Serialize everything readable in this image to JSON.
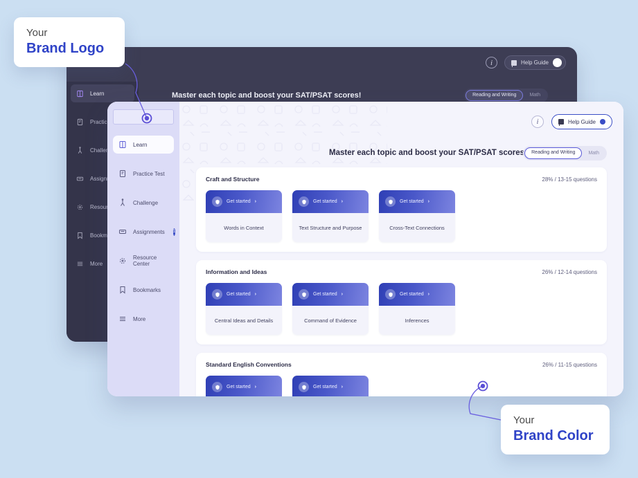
{
  "background_color": "#cbdff2",
  "brand_color": "#3b4ec6",
  "callouts": [
    {
      "id": "brand-logo",
      "small": "Your",
      "big": "Brand Logo"
    },
    {
      "id": "brand-color",
      "small": "Your",
      "big": "Brand Color"
    }
  ],
  "dark_window": {
    "topbar": {
      "info_icon": "info-icon",
      "help_guide_label": "Help Guide",
      "help_guide_toggle": "on"
    },
    "sidebar": {
      "items": [
        {
          "label": "Learn",
          "icon": "learn-icon",
          "active": true
        },
        {
          "label": "Practice Test",
          "icon": "practice-test-icon",
          "active": false
        },
        {
          "label": "Challenge",
          "icon": "challenge-icon",
          "active": false
        },
        {
          "label": "Assignments",
          "icon": "assignments-icon",
          "active": false
        },
        {
          "label": "Resource Center",
          "icon": "resource-center-icon",
          "active": false
        },
        {
          "label": "Bookmarks",
          "icon": "bookmarks-icon",
          "active": false
        },
        {
          "label": "More",
          "icon": "more-icon",
          "active": false
        }
      ]
    },
    "title": "Master each topic and boost your SAT/PSAT scores!",
    "tabs": [
      {
        "label": "Reading and Writing",
        "active": true
      },
      {
        "label": "Math",
        "active": false
      }
    ]
  },
  "light_window": {
    "topbar": {
      "info_icon": "info-icon",
      "help_guide_label": "Help Guide",
      "help_guide_toggle": "on"
    },
    "sidebar": {
      "logo_placeholder": "",
      "items": [
        {
          "label": "Learn",
          "icon": "learn-icon",
          "active": true,
          "badge": ""
        },
        {
          "label": "Practice Test",
          "icon": "practice-test-icon",
          "active": false,
          "badge": ""
        },
        {
          "label": "Challenge",
          "icon": "challenge-icon",
          "active": false,
          "badge": ""
        },
        {
          "label": "Assignments",
          "icon": "assignments-icon",
          "active": false,
          "badge": "1"
        },
        {
          "label": "Resource Center",
          "icon": "resource-center-icon",
          "active": false,
          "badge": ""
        },
        {
          "label": "Bookmarks",
          "icon": "bookmarks-icon",
          "active": false,
          "badge": ""
        },
        {
          "label": "More",
          "icon": "more-icon",
          "active": false,
          "badge": ""
        }
      ]
    },
    "title": "Master each topic and boost your SAT/PSAT scores!",
    "tabs": [
      {
        "label": "Reading and Writing",
        "active": true
      },
      {
        "label": "Math",
        "active": false
      }
    ],
    "sections": [
      {
        "title": "Craft and Structure",
        "meta": "28% / 13-15 questions",
        "cards": [
          {
            "cta": "Get started",
            "chevron": "›",
            "name": "Words in Context"
          },
          {
            "cta": "Get started",
            "chevron": "›",
            "name": "Text Structure and Purpose"
          },
          {
            "cta": "Get started",
            "chevron": "›",
            "name": "Cross-Text Connections"
          }
        ]
      },
      {
        "title": "Information and Ideas",
        "meta": "26% / 12-14 questions",
        "cards": [
          {
            "cta": "Get started",
            "chevron": "›",
            "name": "Central Ideas and Details"
          },
          {
            "cta": "Get started",
            "chevron": "›",
            "name": "Command of Evidence"
          },
          {
            "cta": "Get started",
            "chevron": "›",
            "name": "Inferences"
          }
        ]
      },
      {
        "title": "Standard English Conventions",
        "meta": "26% / 11-15 questions",
        "cards": [
          {
            "cta": "Get started",
            "chevron": "›",
            "name": ""
          },
          {
            "cta": "Get started",
            "chevron": "›",
            "name": ""
          }
        ]
      }
    ]
  }
}
